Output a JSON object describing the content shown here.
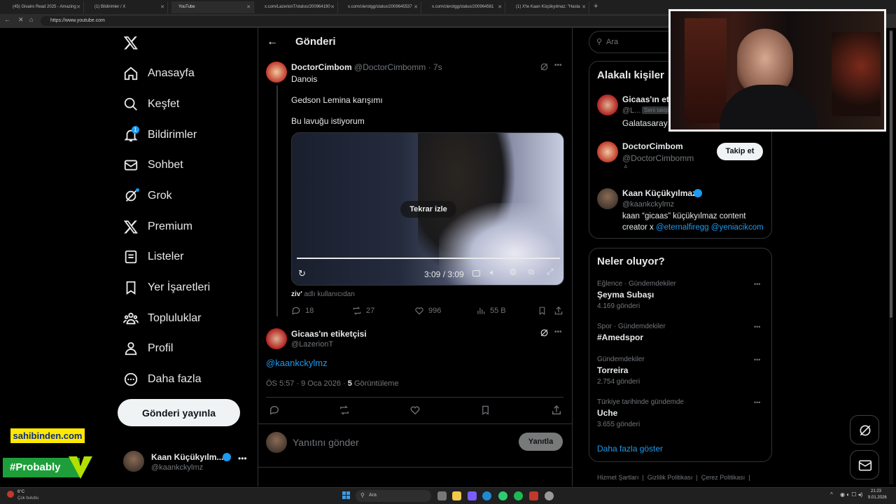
{
  "browser": {
    "tabs": [
      {
        "label": "(45) Givairo Read 2025 - Amazing"
      },
      {
        "label": "(1) Bildirimler / X"
      },
      {
        "label": "YouTube"
      },
      {
        "label": "x.com/LazerionT/status/200964190"
      },
      {
        "label": "x.com/clerotgg/status/2009645537"
      },
      {
        "label": "x.com/clerotgg/status/200964561"
      },
      {
        "label": "(1) X'te Kaan Küçükyılmaz: \"Hasta"
      }
    ],
    "url": "https://www.youtube.com"
  },
  "nav": {
    "items": [
      {
        "label": "Anasayfa"
      },
      {
        "label": "Keşfet"
      },
      {
        "label": "Bildirimler"
      },
      {
        "label": "Sohbet"
      },
      {
        "label": "Grok"
      },
      {
        "label": "Premium"
      },
      {
        "label": "Listeler"
      },
      {
        "label": "Yer İşaretleri"
      },
      {
        "label": "Topluluklar"
      },
      {
        "label": "Profil"
      },
      {
        "label": "Daha fazla"
      }
    ],
    "notification_count": "1",
    "post_button": "Gönderi yayınla",
    "account": {
      "name": "Kaan Küçükyılm...",
      "handle": "@kaankckylmz"
    }
  },
  "main": {
    "header": "Gönderi",
    "parent_tweet": {
      "name": "DoctorCimbom",
      "handle": "@DoctorCimbomm",
      "time": "· 7s",
      "line1": "Danois",
      "line2": "Gedson Lemina karışımı",
      "line3": "Bu lavuğu istiyorum",
      "video": {
        "replay_label": "Tekrar izle",
        "time": "3:09 / 3:09"
      },
      "source_user": "ziv'",
      "source_suffix": "adlı kullanıcıdan",
      "replies": "18",
      "retweets": "27",
      "likes": "996",
      "views": "55 B"
    },
    "main_tweet": {
      "name": "Gicaas'ın etiketçisi",
      "handle": "@LazerionT",
      "text": "@kaankckylmz",
      "timestamp": "ÖS 5:57 · 9 Oca 2026 ·",
      "views_count": "5",
      "views_label": "Görüntüleme"
    },
    "reply_placeholder": "Yanıtını gönder",
    "reply_button": "Yanıtla"
  },
  "right": {
    "search_placeholder": "Ara",
    "relevant_title": "Alakalı kişiler",
    "people": [
      {
        "name": "Gicaas'ın eti",
        "handle": "@L...",
        "badge": "Seni takip",
        "bio": "Galatasaray"
      },
      {
        "name": "DoctorCimbom",
        "handle": "@DoctorCimbomm",
        "bio": "",
        "follow": "Takip et"
      },
      {
        "name": "Kaan Küçükyılmaz",
        "handle": "@kaankckylmz",
        "bio_line1": "kaan “gicaas” küçükyılmaz content",
        "bio_line2_prefix": "creator x",
        "bio_link1": "@eternalfiregg",
        "bio_link2": "@yeniacikcom"
      }
    ],
    "trends_title": "Neler oluyor?",
    "trends": [
      {
        "context": "Eğlence · Gündemdekiler",
        "title": "Şeyma Subaşı",
        "count": "4.169 gönderi"
      },
      {
        "context": "Spor · Gündemdekiler",
        "title": "#Amedspor",
        "count": ""
      },
      {
        "context": "Gündemdekiler",
        "title": "Torreira",
        "count": "2.754 gönderi"
      },
      {
        "context": "Türkiye tarihinde gündemde",
        "title": "Uche",
        "count": "3.655 gönderi"
      }
    ],
    "show_more": "Daha fazla göster",
    "footer": [
      "Hizmet Şartları",
      "Gizlilik Politikası",
      "Çerez Politikası"
    ]
  },
  "overlays": {
    "sahibinden": "sahibinden.com",
    "probably": "#Probably"
  },
  "taskbar": {
    "weather_temp": "6°C",
    "weather_desc": "Çok bulutlu",
    "search": "Ara",
    "time": "21:23",
    "date": "9.01.2026"
  },
  "colors": {
    "accent": "#1d9bf0",
    "background": "#000000",
    "border": "#2f3336",
    "muted": "#71767b"
  }
}
